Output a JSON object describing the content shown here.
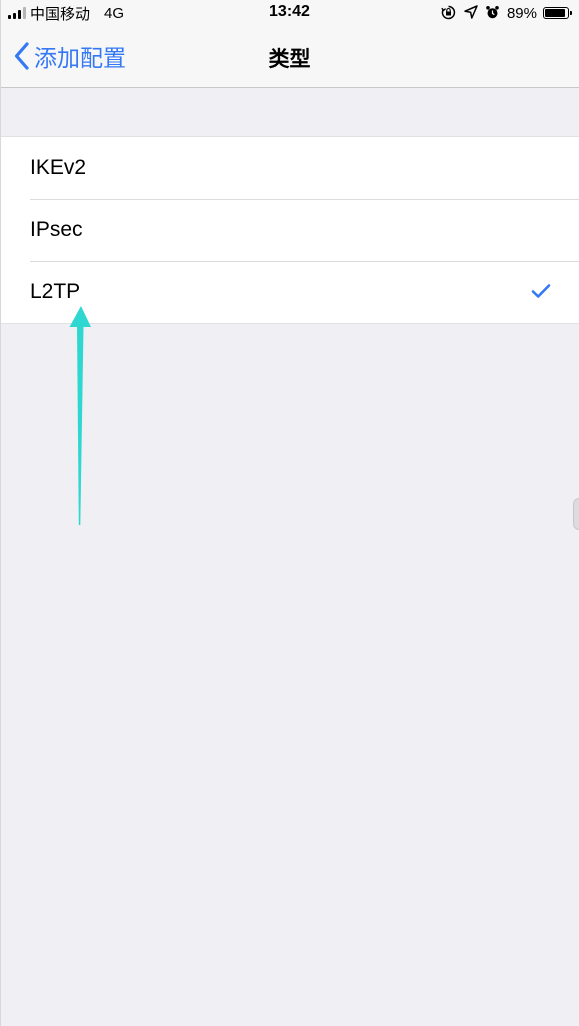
{
  "status_bar": {
    "carrier": "中国移动",
    "network": "4G",
    "time": "13:42",
    "battery_percent": "89%",
    "battery_level": 0.89,
    "icons": [
      "orientation-lock-icon",
      "location-icon",
      "alarm-icon"
    ]
  },
  "nav": {
    "back_label": "添加配置",
    "title": "类型"
  },
  "vpn_types": {
    "items": [
      {
        "label": "IKEv2",
        "selected": false
      },
      {
        "label": "IPsec",
        "selected": false
      },
      {
        "label": "L2TP",
        "selected": true
      }
    ]
  },
  "colors": {
    "accent": "#3478f6",
    "annotation_arrow": "#2ed8d0",
    "background": "#efeff4"
  }
}
